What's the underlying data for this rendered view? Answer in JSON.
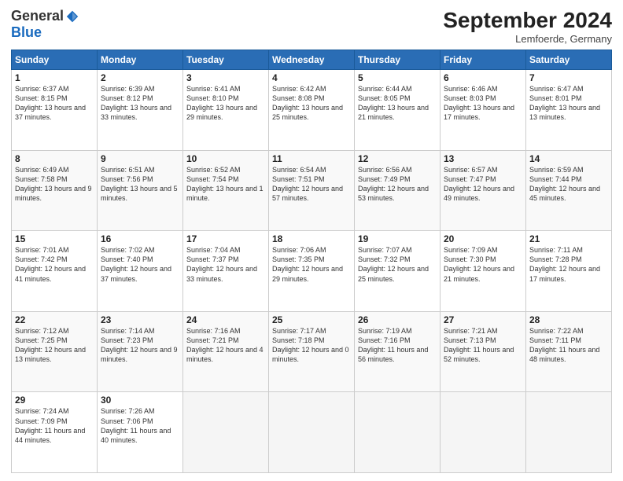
{
  "header": {
    "logo_general": "General",
    "logo_blue": "Blue",
    "month_title": "September 2024",
    "location": "Lemfoerde, Germany"
  },
  "weekdays": [
    "Sunday",
    "Monday",
    "Tuesday",
    "Wednesday",
    "Thursday",
    "Friday",
    "Saturday"
  ],
  "weeks": [
    [
      {
        "day": "1",
        "sunrise": "6:37 AM",
        "sunset": "8:15 PM",
        "daylight": "13 hours and 37 minutes."
      },
      {
        "day": "2",
        "sunrise": "6:39 AM",
        "sunset": "8:12 PM",
        "daylight": "13 hours and 33 minutes."
      },
      {
        "day": "3",
        "sunrise": "6:41 AM",
        "sunset": "8:10 PM",
        "daylight": "13 hours and 29 minutes."
      },
      {
        "day": "4",
        "sunrise": "6:42 AM",
        "sunset": "8:08 PM",
        "daylight": "13 hours and 25 minutes."
      },
      {
        "day": "5",
        "sunrise": "6:44 AM",
        "sunset": "8:05 PM",
        "daylight": "13 hours and 21 minutes."
      },
      {
        "day": "6",
        "sunrise": "6:46 AM",
        "sunset": "8:03 PM",
        "daylight": "13 hours and 17 minutes."
      },
      {
        "day": "7",
        "sunrise": "6:47 AM",
        "sunset": "8:01 PM",
        "daylight": "13 hours and 13 minutes."
      }
    ],
    [
      {
        "day": "8",
        "sunrise": "6:49 AM",
        "sunset": "7:58 PM",
        "daylight": "13 hours and 9 minutes."
      },
      {
        "day": "9",
        "sunrise": "6:51 AM",
        "sunset": "7:56 PM",
        "daylight": "13 hours and 5 minutes."
      },
      {
        "day": "10",
        "sunrise": "6:52 AM",
        "sunset": "7:54 PM",
        "daylight": "13 hours and 1 minute."
      },
      {
        "day": "11",
        "sunrise": "6:54 AM",
        "sunset": "7:51 PM",
        "daylight": "12 hours and 57 minutes."
      },
      {
        "day": "12",
        "sunrise": "6:56 AM",
        "sunset": "7:49 PM",
        "daylight": "12 hours and 53 minutes."
      },
      {
        "day": "13",
        "sunrise": "6:57 AM",
        "sunset": "7:47 PM",
        "daylight": "12 hours and 49 minutes."
      },
      {
        "day": "14",
        "sunrise": "6:59 AM",
        "sunset": "7:44 PM",
        "daylight": "12 hours and 45 minutes."
      }
    ],
    [
      {
        "day": "15",
        "sunrise": "7:01 AM",
        "sunset": "7:42 PM",
        "daylight": "12 hours and 41 minutes."
      },
      {
        "day": "16",
        "sunrise": "7:02 AM",
        "sunset": "7:40 PM",
        "daylight": "12 hours and 37 minutes."
      },
      {
        "day": "17",
        "sunrise": "7:04 AM",
        "sunset": "7:37 PM",
        "daylight": "12 hours and 33 minutes."
      },
      {
        "day": "18",
        "sunrise": "7:06 AM",
        "sunset": "7:35 PM",
        "daylight": "12 hours and 29 minutes."
      },
      {
        "day": "19",
        "sunrise": "7:07 AM",
        "sunset": "7:32 PM",
        "daylight": "12 hours and 25 minutes."
      },
      {
        "day": "20",
        "sunrise": "7:09 AM",
        "sunset": "7:30 PM",
        "daylight": "12 hours and 21 minutes."
      },
      {
        "day": "21",
        "sunrise": "7:11 AM",
        "sunset": "7:28 PM",
        "daylight": "12 hours and 17 minutes."
      }
    ],
    [
      {
        "day": "22",
        "sunrise": "7:12 AM",
        "sunset": "7:25 PM",
        "daylight": "12 hours and 13 minutes."
      },
      {
        "day": "23",
        "sunrise": "7:14 AM",
        "sunset": "7:23 PM",
        "daylight": "12 hours and 9 minutes."
      },
      {
        "day": "24",
        "sunrise": "7:16 AM",
        "sunset": "7:21 PM",
        "daylight": "12 hours and 4 minutes."
      },
      {
        "day": "25",
        "sunrise": "7:17 AM",
        "sunset": "7:18 PM",
        "daylight": "12 hours and 0 minutes."
      },
      {
        "day": "26",
        "sunrise": "7:19 AM",
        "sunset": "7:16 PM",
        "daylight": "11 hours and 56 minutes."
      },
      {
        "day": "27",
        "sunrise": "7:21 AM",
        "sunset": "7:13 PM",
        "daylight": "11 hours and 52 minutes."
      },
      {
        "day": "28",
        "sunrise": "7:22 AM",
        "sunset": "7:11 PM",
        "daylight": "11 hours and 48 minutes."
      }
    ],
    [
      {
        "day": "29",
        "sunrise": "7:24 AM",
        "sunset": "7:09 PM",
        "daylight": "11 hours and 44 minutes."
      },
      {
        "day": "30",
        "sunrise": "7:26 AM",
        "sunset": "7:06 PM",
        "daylight": "11 hours and 40 minutes."
      },
      null,
      null,
      null,
      null,
      null
    ]
  ]
}
